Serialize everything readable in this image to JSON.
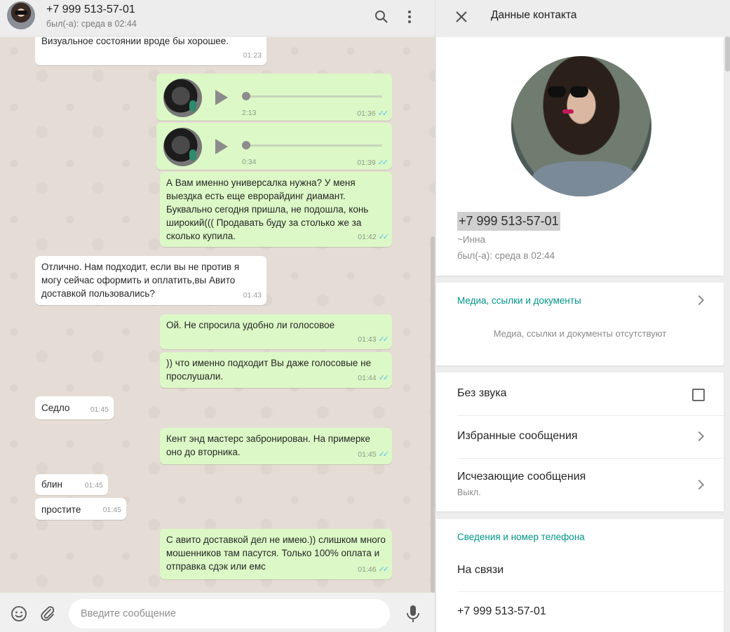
{
  "chat": {
    "contact_phone": "+7 999 513-57-01",
    "last_seen": "был(-а): среда в 02:44",
    "composer_placeholder": "Введите сообщение",
    "messages": [
      {
        "dir": "in",
        "text": "Визуальное состоянии вроде бы хорошее.",
        "time": "01:23"
      },
      {
        "dir": "out",
        "type": "voice",
        "duration": "2:13",
        "time": "01:36"
      },
      {
        "dir": "out",
        "type": "voice",
        "duration": "0:34",
        "time": "01:39"
      },
      {
        "dir": "out",
        "text": "А Вам именно универсалка нужна?  У меня выездка есть еще еврорайдинг диамант. Буквально сегодня пришла,  не подошла,  конь широкий((( Продавать буду за столько же за сколько купила.",
        "time": "01:42"
      },
      {
        "dir": "in",
        "text": "Отлично. Нам подходит, если вы не против я могу сейчас оформить и оплатить,вы Авито доставкой пользовались?",
        "time": "01:43"
      },
      {
        "dir": "out",
        "text": "Ой.  Не спросила удобно ли голосовое",
        "time": "01:43"
      },
      {
        "dir": "out",
        "text": ")) что именно подходит Вы даже голосовые не прослушали.",
        "time": "01:44"
      },
      {
        "dir": "in",
        "text": "Седло",
        "time": "01:45"
      },
      {
        "dir": "out",
        "text": "Кент энд мастерс забронирован. На примерке оно до вторника.",
        "time": "01:45"
      },
      {
        "dir": "in",
        "text": "блин",
        "time": "01:45"
      },
      {
        "dir": "in",
        "text": "простите",
        "time": "01:45"
      },
      {
        "dir": "out",
        "text": "С авито доставкой дел не имею.))  слишком много мошенников там пасутся.  Только 100% оплата и отправка сдэк или емс",
        "time": "01:46"
      }
    ]
  },
  "contact": {
    "panel_title": "Данные контакта",
    "phone": "+7 999 513-57-01",
    "name": "~Инна",
    "last_seen": "был(-а): среда в 02:44",
    "media_title": "Медиа, ссылки и документы",
    "media_empty": "Медиа, ссылки и документы отсутствуют",
    "mute_label": "Без звука",
    "starred_label": "Избранные сообщения",
    "disappearing_label": "Исчезающие сообщения",
    "disappearing_value": "Выкл.",
    "about_title": "Сведения и номер телефона",
    "about_text": "На связи",
    "about_phone": "+7 999 513-57-01"
  },
  "colors": {
    "accent": "#009688",
    "outgoing": "#dcf8c6",
    "tick": "#4fc3f7"
  }
}
